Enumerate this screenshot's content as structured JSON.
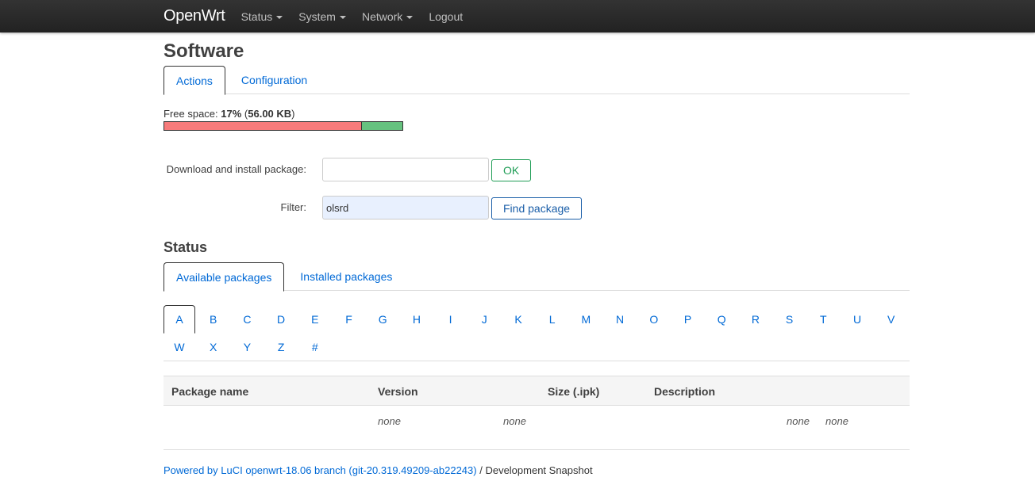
{
  "navbar": {
    "brand": "OpenWrt",
    "items": [
      {
        "label": "Status",
        "has_caret": true
      },
      {
        "label": "System",
        "has_caret": true
      },
      {
        "label": "Network",
        "has_caret": true
      },
      {
        "label": "Logout",
        "has_caret": false
      }
    ]
  },
  "page": {
    "title": "Software",
    "tabs": [
      {
        "label": "Actions",
        "active": true
      },
      {
        "label": "Configuration",
        "active": false
      }
    ]
  },
  "free_space": {
    "label_prefix": "Free space: ",
    "percent_text": "17%",
    "size_open": " (",
    "size_text": "56.00 KB",
    "size_close": ")",
    "used_fraction": 0.83,
    "used_color": "#f77b7b",
    "free_color": "#66c27f"
  },
  "download": {
    "label": "Download and install package:",
    "value": "",
    "button": "OK"
  },
  "filter": {
    "label": "Filter:",
    "value": "olsrd",
    "button": "Find package"
  },
  "status": {
    "title": "Status",
    "tabs": [
      {
        "label": "Available packages",
        "active": true
      },
      {
        "label": "Installed packages",
        "active": false
      }
    ],
    "letters": [
      "A",
      "B",
      "C",
      "D",
      "E",
      "F",
      "G",
      "H",
      "I",
      "J",
      "K",
      "L",
      "M",
      "N",
      "O",
      "P",
      "Q",
      "R",
      "S",
      "T",
      "U",
      "V",
      "W",
      "X",
      "Y",
      "Z",
      "#"
    ],
    "active_letter": "A"
  },
  "table": {
    "headers": [
      "Package name",
      "Version",
      "Size (.ipk)",
      "Description"
    ],
    "row": [
      "none",
      "none",
      "none",
      "none"
    ]
  },
  "footer": {
    "link": "Powered by LuCI openwrt-18.06 branch (git-20.319.49209-ab22243)",
    "suffix": " / Development Snapshot"
  },
  "colors": {
    "link": "#0069d6",
    "ok_button": "#1f9d55",
    "find_button": "#1a5ea8"
  }
}
